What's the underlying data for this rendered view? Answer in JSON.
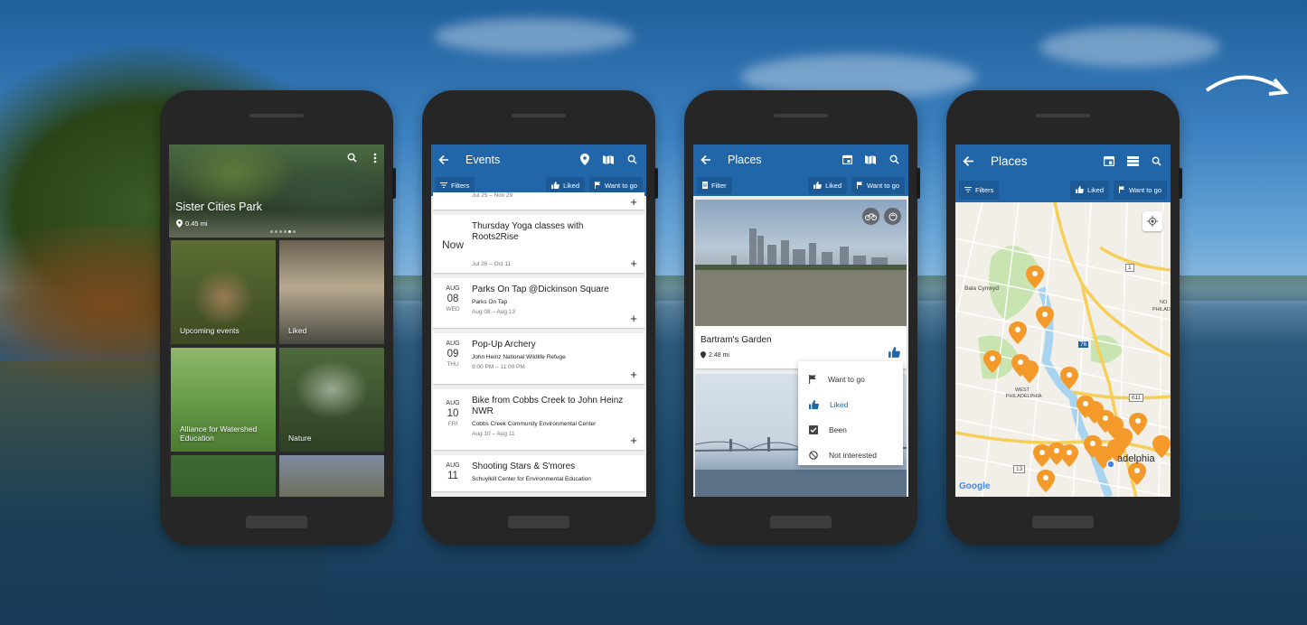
{
  "colors": {
    "primary": "#2266aa",
    "pin": "#f39a2a",
    "park_green": "#c8e4b0"
  },
  "phone1": {
    "park_title": "Sister Cities Park",
    "distance": "0.45 mi",
    "tiles": [
      {
        "label": "Upcoming events"
      },
      {
        "label": "Liked"
      },
      {
        "label": "Alliance for Watershed Education"
      },
      {
        "label": "Nature"
      },
      {
        "label": ""
      },
      {
        "label": ""
      }
    ]
  },
  "phone2": {
    "title": "Events",
    "filters_label": "Filters",
    "liked_label": "Liked",
    "want_label": "Want to go",
    "first_partial_time": "Jul 25 – Nov 29",
    "events": [
      {
        "now": "Now",
        "name": "Thursday Yoga classes with Roots2Rise",
        "time": "Jul 26 – Oct 11"
      },
      {
        "mon": "AUG",
        "day": "08",
        "wd": "WED",
        "name": "Parks On Tap @Dickinson Square",
        "venue": "Parks On Tap",
        "time": "Aug 08 – Aug 13"
      },
      {
        "mon": "AUG",
        "day": "09",
        "wd": "THU",
        "name": "Pop-Up Archery",
        "venue": "John Heinz National Wildlife Refuge",
        "time": "9:00 PM – 11:00 PM"
      },
      {
        "mon": "AUG",
        "day": "10",
        "wd": "FRI",
        "name": "Bike from Cobbs Creek to John Heinz NWR",
        "venue": "Cobbs Creek Community Environmental Center",
        "time": "Aug 10 – Aug 11"
      },
      {
        "mon": "AUG",
        "day": "11",
        "wd": "",
        "name": "Shooting Stars & S'mores",
        "venue": "Schuylkill Center for Environmental Education",
        "time": ""
      }
    ]
  },
  "phone3": {
    "title": "Places",
    "filter_label": "Filter",
    "liked_label": "Liked",
    "want_label": "Want to go",
    "place_name": "Bartram's Garden",
    "distance": "2.48 mi",
    "menu": [
      {
        "label": "Want to go",
        "icon": "flag-icon"
      },
      {
        "label": "Liked",
        "icon": "thumb-up-icon"
      },
      {
        "label": "Been",
        "icon": "check-box-icon"
      },
      {
        "label": "Not interested",
        "icon": "block-icon"
      }
    ]
  },
  "phone4": {
    "title": "Places",
    "filters_label": "Filters",
    "liked_label": "Liked",
    "want_label": "Want to go",
    "map_labels": {
      "bala": "Bala Cynwyd",
      "west1": "WEST",
      "west2": "PHILADELPHIA",
      "nor1": "NO",
      "nor2": "PHILAD",
      "city": "adelphia",
      "r1": "1",
      "r76": "76",
      "r611": "611",
      "r13": "13"
    },
    "google": "Google"
  }
}
